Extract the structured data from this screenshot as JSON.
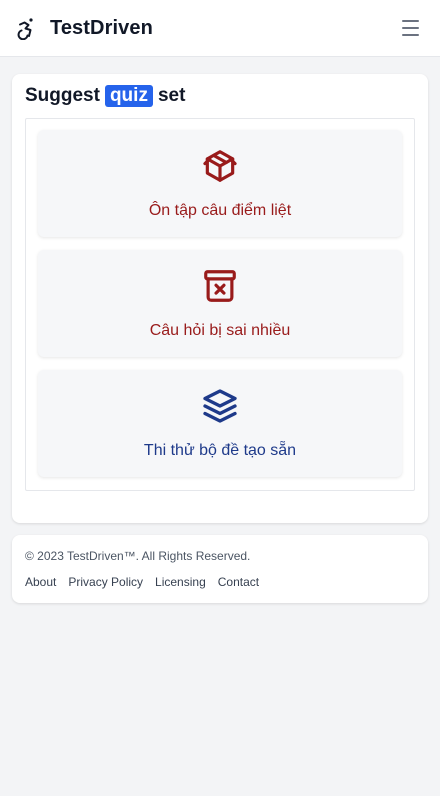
{
  "header": {
    "brand_name": "TestDriven",
    "logo_icon": "accessibility-icon",
    "menu_icon": "hamburger-menu-icon"
  },
  "suggest": {
    "title_before": "Suggest",
    "title_badge": "quiz",
    "title_after": "set",
    "options": [
      {
        "label": "Ôn tập câu điểm liệt",
        "icon": "package-icon",
        "color": "#991b1b"
      },
      {
        "label": "Câu hỏi bị sai nhiều",
        "icon": "archive-x-icon",
        "color": "#991b1b"
      },
      {
        "label": "Thi thử bộ đề tạo sẵn",
        "icon": "layers-icon",
        "color": "#1e3a8a"
      }
    ]
  },
  "footer": {
    "copyright": "© 2023 TestDriven™. All Rights Reserved.",
    "links": [
      "About",
      "Privacy Policy",
      "Licensing",
      "Contact"
    ]
  },
  "colors": {
    "accent": "#2563eb",
    "red": "#991b1b",
    "blue": "#1e3a8a",
    "page_bg": "#f3f4f6"
  }
}
